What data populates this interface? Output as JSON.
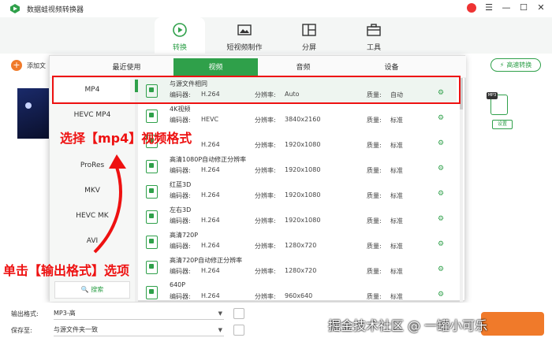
{
  "app": {
    "title": "数据蛙视频转换器"
  },
  "main_tabs": [
    {
      "label": "转换",
      "icon": "convert-icon"
    },
    {
      "label": "短视频制作",
      "icon": "short-video-icon"
    },
    {
      "label": "分屏",
      "icon": "split-screen-icon"
    },
    {
      "label": "工具",
      "icon": "toolbox-icon"
    }
  ],
  "toolbar": {
    "add_file": "添加文",
    "speed_convert": "高速转换",
    "setting": "设置"
  },
  "popup": {
    "tabs": [
      "最近使用",
      "视频",
      "音频",
      "设备"
    ],
    "formats": [
      "MP4",
      "HEVC MP4",
      "",
      "ProRes",
      "MKV",
      "HEVC MK",
      "AVI"
    ],
    "search": "搜索",
    "presets": [
      {
        "name": "与源文件相同",
        "encoder_label": "编码器:",
        "encoder": "H.264",
        "res_label": "分辨率:",
        "res": "Auto",
        "quality_label": "质量:",
        "quality": "自动"
      },
      {
        "name": "4K视频",
        "encoder_label": "编码器:",
        "encoder": "HEVC",
        "res_label": "分辨率:",
        "res": "3840x2160",
        "quality_label": "质量:",
        "quality": "标准"
      },
      {
        "name": "",
        "encoder_label": "",
        "encoder": "H.264",
        "res_label": "分辨率:",
        "res": "1920x1080",
        "quality_label": "质量:",
        "quality": "标准"
      },
      {
        "name": "高清1080P自动修正分辨率",
        "encoder_label": "编码器:",
        "encoder": "H.264",
        "res_label": "分辨率:",
        "res": "1920x1080",
        "quality_label": "质量:",
        "quality": "标准"
      },
      {
        "name": "红蓝3D",
        "encoder_label": "编码器:",
        "encoder": "H.264",
        "res_label": "分辨率:",
        "res": "1920x1080",
        "quality_label": "质量:",
        "quality": "标准"
      },
      {
        "name": "左右3D",
        "encoder_label": "编码器:",
        "encoder": "H.264",
        "res_label": "分辨率:",
        "res": "1920x1080",
        "quality_label": "质量:",
        "quality": "标准"
      },
      {
        "name": "高清720P",
        "encoder_label": "编码器:",
        "encoder": "H.264",
        "res_label": "分辨率:",
        "res": "1280x720",
        "quality_label": "质量:",
        "quality": "标准"
      },
      {
        "name": "高清720P自动修正分辨率",
        "encoder_label": "编码器:",
        "encoder": "H.264",
        "res_label": "分辨率:",
        "res": "1280x720",
        "quality_label": "质量:",
        "quality": "标准"
      },
      {
        "name": "640P",
        "encoder_label": "编码器:",
        "encoder": "H.264",
        "res_label": "分辨率:",
        "res": "960x640",
        "quality_label": "质量:",
        "quality": "标准"
      }
    ]
  },
  "bottom": {
    "output_label": "输出格式:",
    "output_value": "MP3-高",
    "save_label": "保存至:",
    "save_value": "与源文件夹一致"
  },
  "annotations": {
    "select_mp4": "选择【mp4】视频格式",
    "click_output": "单击【输出格式】选项",
    "watermark": "掘金技术社区 @ 一罐小可乐",
    "color": "#e11111"
  },
  "colors": {
    "accent": "#2fa04a",
    "orange": "#f07a2a"
  }
}
